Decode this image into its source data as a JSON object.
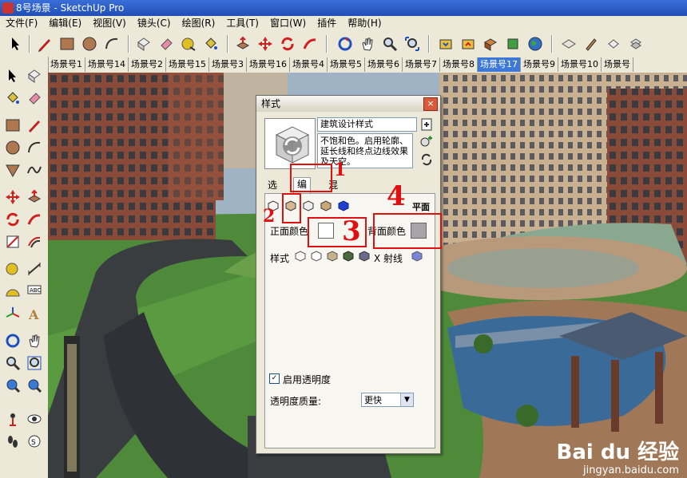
{
  "window": {
    "title": "8号场景 - SketchUp Pro"
  },
  "menu": [
    "文件(F)",
    "编辑(E)",
    "视图(V)",
    "镜头(C)",
    "绘图(R)",
    "工具(T)",
    "窗口(W)",
    "插件",
    "帮助(H)"
  ],
  "scene_tabs": [
    "场景号1",
    "场景号14",
    "场景号2",
    "场景号15",
    "场景号3",
    "场景号16",
    "场景号4",
    "场景号5",
    "场景号6",
    "场景号7",
    "场景号8",
    "场景号17",
    "场景号9",
    "场景号10",
    "场景号"
  ],
  "active_tab_index": 11,
  "styles_dialog": {
    "title": "样式",
    "close": "×",
    "style_name": "建筑设计样式",
    "description": "不饱和色。启用轮廓、延长线和终点边线效果及天空。",
    "tabs": [
      "选择",
      "编辑",
      "混合"
    ],
    "selected_tab": "编辑",
    "face_mode_label": "平面",
    "front_color_label": "正面颜色",
    "back_color_label": "背面颜色",
    "front_color": "#ffffff",
    "back_color": "#a8a4a8",
    "style_row_label": "样式",
    "xray_label": "X 射线",
    "transparency_label": "启用透明度",
    "transparency_checked": "✓",
    "quality_label": "透明度质量:",
    "quality_value": "更快"
  },
  "annotations": [
    "1",
    "2",
    "3",
    "4"
  ],
  "watermark": {
    "logo": "Bai du 经验",
    "url": "jingyan.baidu.com"
  }
}
